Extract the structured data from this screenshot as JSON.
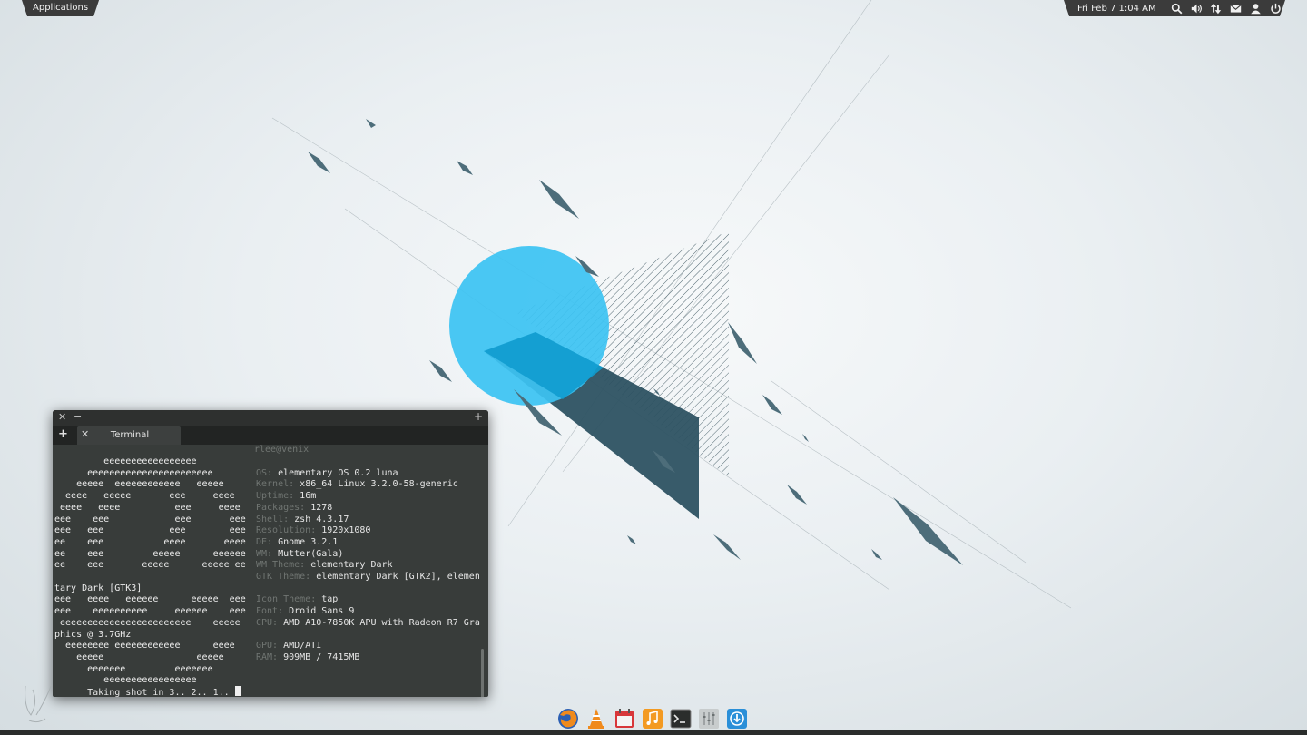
{
  "panel": {
    "applications_label": "Applications",
    "clock": "Fri Feb  7  1:04 AM",
    "indicators": [
      "search-icon",
      "volume-icon",
      "network-icon",
      "mail-icon",
      "user-icon",
      "power-icon"
    ]
  },
  "terminal": {
    "tab_label": "Terminal",
    "user_host": "rlee@venix",
    "lines": [
      {
        "art": "         eeeeeeeeeeeeeeeee        ",
        "label": "",
        "value": ""
      },
      {
        "art": "      eeeeeeeeeeeeeeeeeeeeeee     ",
        "label": "OS: ",
        "value": "elementary OS 0.2 luna"
      },
      {
        "art": "    eeeee  eeeeeeeeeeee   eeeee  ",
        "label": "Kernel: ",
        "value": "x86_64 Linux 3.2.0-58-generic"
      },
      {
        "art": "  eeee   eeeee       eee     eeee",
        "label": "Uptime: ",
        "value": "16m"
      },
      {
        "art": " eeee   eeee          eee     eeee",
        "label": "Packages: ",
        "value": "1278"
      },
      {
        "art": "eee    eee            eee       eee",
        "label": "Shell: ",
        "value": "zsh 4.3.17"
      },
      {
        "art": "eee   eee            eee        eee",
        "label": "Resolution: ",
        "value": "1920x1080"
      },
      {
        "art": "ee    eee           eeee       eeee",
        "label": "DE: ",
        "value": "Gnome 3.2.1"
      },
      {
        "art": "ee    eee         eeeee      eeeeee",
        "label": "WM: ",
        "value": "Mutter(Gala)"
      },
      {
        "art": "ee    eee       eeeee      eeeee ee",
        "label": "WM Theme: ",
        "value": "elementary Dark"
      },
      {
        "art": "",
        "label": "GTK Theme: ",
        "value": "elementary Dark [GTK2], elemen"
      },
      {
        "art": "tary Dark [GTK3]",
        "label": "",
        "value": ""
      },
      {
        "art": "eee   eeee   eeeeee      eeeee  eee",
        "label": "Icon Theme: ",
        "value": "tap"
      },
      {
        "art": "eee    eeeeeeeeee     eeeeee    eee",
        "label": "Font: ",
        "value": "Droid Sans 9"
      },
      {
        "art": " eeeeeeeeeeeeeeeeeeeeeeee    eeeee",
        "label": "CPU: ",
        "value": "AMD A10-7850K APU with Radeon R7 Gra"
      },
      {
        "art": "phics @ 3.7GHz",
        "label": "",
        "value": ""
      },
      {
        "art": "  eeeeeeee eeeeeeeeeeee      eeee",
        "label": "GPU: ",
        "value": "AMD/ATI"
      },
      {
        "art": "    eeeee                 eeeee",
        "label": "RAM: ",
        "value": "909MB / 7415MB"
      },
      {
        "art": "      eeeeeee         eeeeeee",
        "label": "",
        "value": ""
      },
      {
        "art": "         eeeeeeeeeeeeeeeee",
        "label": "",
        "value": ""
      }
    ],
    "prompt_text": "Taking shot in 3.. 2.. 1.. "
  },
  "dock": {
    "items": [
      "firefox-icon",
      "vlc-icon",
      "calendar-icon",
      "music-icon",
      "terminal-icon",
      "equalizer-icon",
      "download-icon"
    ]
  },
  "colors": {
    "circle": "#3cc3f2",
    "panel": "#3b3b3b",
    "terminal_bg": "#383c3a",
    "shape_dark": "#2d5262"
  }
}
